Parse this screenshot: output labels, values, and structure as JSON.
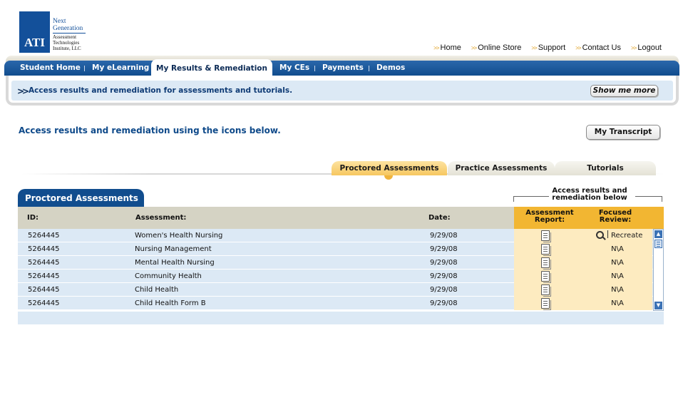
{
  "logo": {
    "mark": "ATI",
    "next": "Next",
    "generation": "Generation",
    "company_1": "Assessment",
    "company_2": "Technologies",
    "company_3": "Institute, LLC"
  },
  "toplinks": {
    "arrow": ">>",
    "items": [
      "Home",
      "Online Store",
      "Support",
      "Contact Us",
      "Logout"
    ]
  },
  "nav": {
    "items": [
      "Student Home",
      "My eLearning",
      "My Results & Remediation",
      "My CEs",
      "Payments",
      "Demos"
    ],
    "active_index": 2
  },
  "infobar": {
    "chevron": ">>",
    "text": "Access results and remediation for assessments and tutorials.",
    "button": "Show me more"
  },
  "page": {
    "heading": "Access results and remediation using the icons below.",
    "transcript_button": "My Transcript"
  },
  "subtabs": [
    "Proctored Assessments",
    "Practice Assessments",
    "Tutorials"
  ],
  "panel": {
    "title": "Proctored Assessments",
    "bracket_line1": "Access results and",
    "bracket_line2": "remediation below",
    "columns": {
      "id": "ID:",
      "assessment": "Assessment:",
      "date": "Date:",
      "report_1": "Assessment",
      "report_2": "Report:",
      "focused_1": "Focused",
      "focused_2": "Review:"
    },
    "rows": [
      {
        "id": "5264445",
        "assessment": "Women's Health Nursing",
        "date": "9/29/08",
        "focused": "Recreate"
      },
      {
        "id": "5264445",
        "assessment": "Nursing Management",
        "date": "9/29/08",
        "focused": "N\\A"
      },
      {
        "id": "5264445",
        "assessment": "Mental Health Nursing",
        "date": "9/29/08",
        "focused": "N\\A"
      },
      {
        "id": "5264445",
        "assessment": "Community Health",
        "date": "9/29/08",
        "focused": "N\\A"
      },
      {
        "id": "5264445",
        "assessment": "Child Health",
        "date": "9/29/08",
        "focused": "N\\A"
      },
      {
        "id": "5264445",
        "assessment": "Child Health Form B",
        "date": "9/29/08",
        "focused": "N\\A"
      }
    ],
    "icons": {
      "report": "document-icon",
      "focused": "magnifier-key-icon",
      "scroll_up": "arrow-up-icon",
      "scroll_down": "arrow-down-icon"
    }
  },
  "colors": {
    "navy": "#114d8e",
    "light_blue": "#dce9f5",
    "gold": "#f2b632",
    "pale_gold": "#fdebc0",
    "tan": "#d5d3c4"
  }
}
